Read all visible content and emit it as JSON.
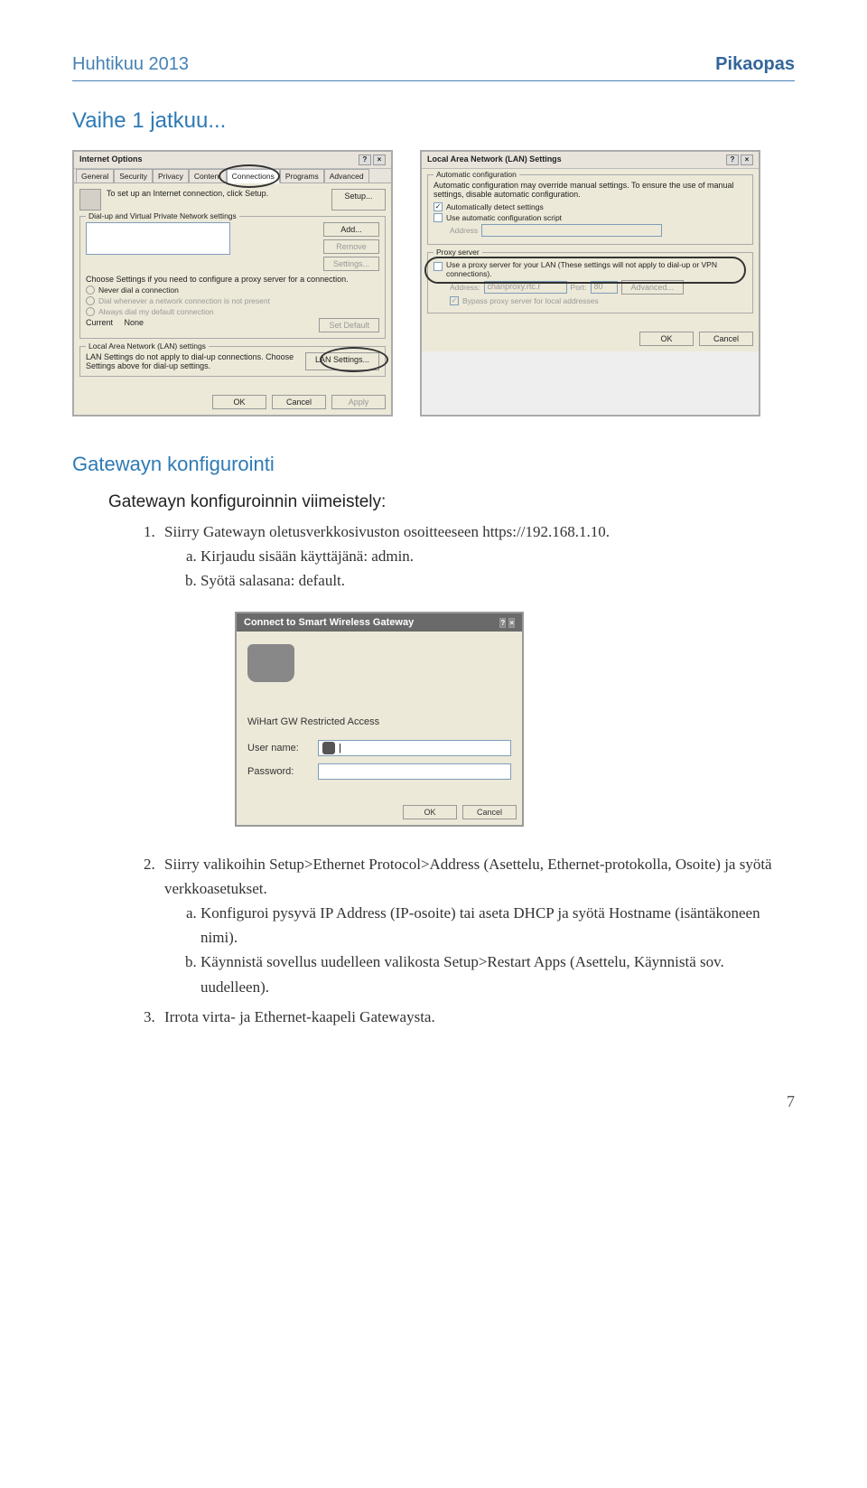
{
  "header": {
    "left": "Huhtikuu 2013",
    "right": "Pikaopas"
  },
  "section1": {
    "title": "Vaihe 1 jatkuu..."
  },
  "dialog_internet_options": {
    "title": "Internet Options",
    "tabs": [
      "General",
      "Security",
      "Privacy",
      "Content",
      "Connections",
      "Programs",
      "Advanced"
    ],
    "info_text": "To set up an Internet connection, click Setup.",
    "setup_btn": "Setup...",
    "fieldset_dial": {
      "legend": "Dial-up and Virtual Private Network settings",
      "add_btn": "Add...",
      "remove_btn": "Remove",
      "settings_btn": "Settings...",
      "choose_text": "Choose Settings if you need to configure a proxy server for a connection.",
      "radios": [
        "Never dial a connection",
        "Dial whenever a network connection is not present",
        "Always dial my default connection"
      ],
      "current_label": "Current",
      "current_value": "None",
      "set_default_btn": "Set Default"
    },
    "fieldset_lan": {
      "legend": "Local Area Network (LAN) settings",
      "text": "LAN Settings do not apply to dial-up connections. Choose Settings above for dial-up settings.",
      "lan_btn": "LAN Settings..."
    },
    "buttons": {
      "ok": "OK",
      "cancel": "Cancel",
      "apply": "Apply"
    }
  },
  "dialog_lan": {
    "title": "Local Area Network (LAN) Settings",
    "auto_group": {
      "legend": "Automatic configuration",
      "text": "Automatic configuration may override manual settings. To ensure the use of manual settings, disable automatic configuration.",
      "cb1": "Automatically detect settings",
      "cb2": "Use automatic configuration script",
      "addr_label": "Address"
    },
    "proxy_group": {
      "legend": "Proxy server",
      "cb1": "Use a proxy server for your LAN (These settings will not apply to dial-up or VPN connections).",
      "addr_label": "Address:",
      "addr_value": "chanproxy.rtc.r",
      "port_label": "Port:",
      "port_value": "80",
      "adv_btn": "Advanced...",
      "bypass": "Bypass proxy server for local addresses"
    },
    "buttons": {
      "ok": "OK",
      "cancel": "Cancel"
    }
  },
  "gateway_config": {
    "title": "Gatewayn konfigurointi",
    "sub_heading": "Gatewayn konfiguroinnin viimeistely:",
    "steps": {
      "s1": "Siirry Gatewayn oletusverkkosivuston osoitteeseen https://192.168.1.10.",
      "s1a": "Kirjaudu sisään käyttäjänä: admin.",
      "s1b": "Syötä salasana: default.",
      "s2": "Siirry valikoihin Setup>Ethernet Protocol>Address (Asettelu, Ethernet-protokolla, Osoite) ja syötä verkkoasetukset.",
      "s2a": "Konfiguroi pysyvä IP Address (IP-osoite) tai aseta DHCP ja syötä Hostname (isäntäkoneen nimi).",
      "s2b": "Käynnistä sovellus uudelleen valikosta Setup>Restart Apps (Asettelu, Käynnistä sov. uudelleen).",
      "s3": "Irrota virta- ja Ethernet-kaapeli Gatewaysta."
    }
  },
  "connect_dialog": {
    "title": "Connect to Smart Wireless Gateway",
    "access_text": "WiHart GW Restricted Access",
    "user_label": "User name:",
    "user_value": "",
    "pass_label": "Password:",
    "pass_value": "",
    "buttons": {
      "ok": "OK",
      "cancel": "Cancel"
    }
  },
  "page_number": "7"
}
